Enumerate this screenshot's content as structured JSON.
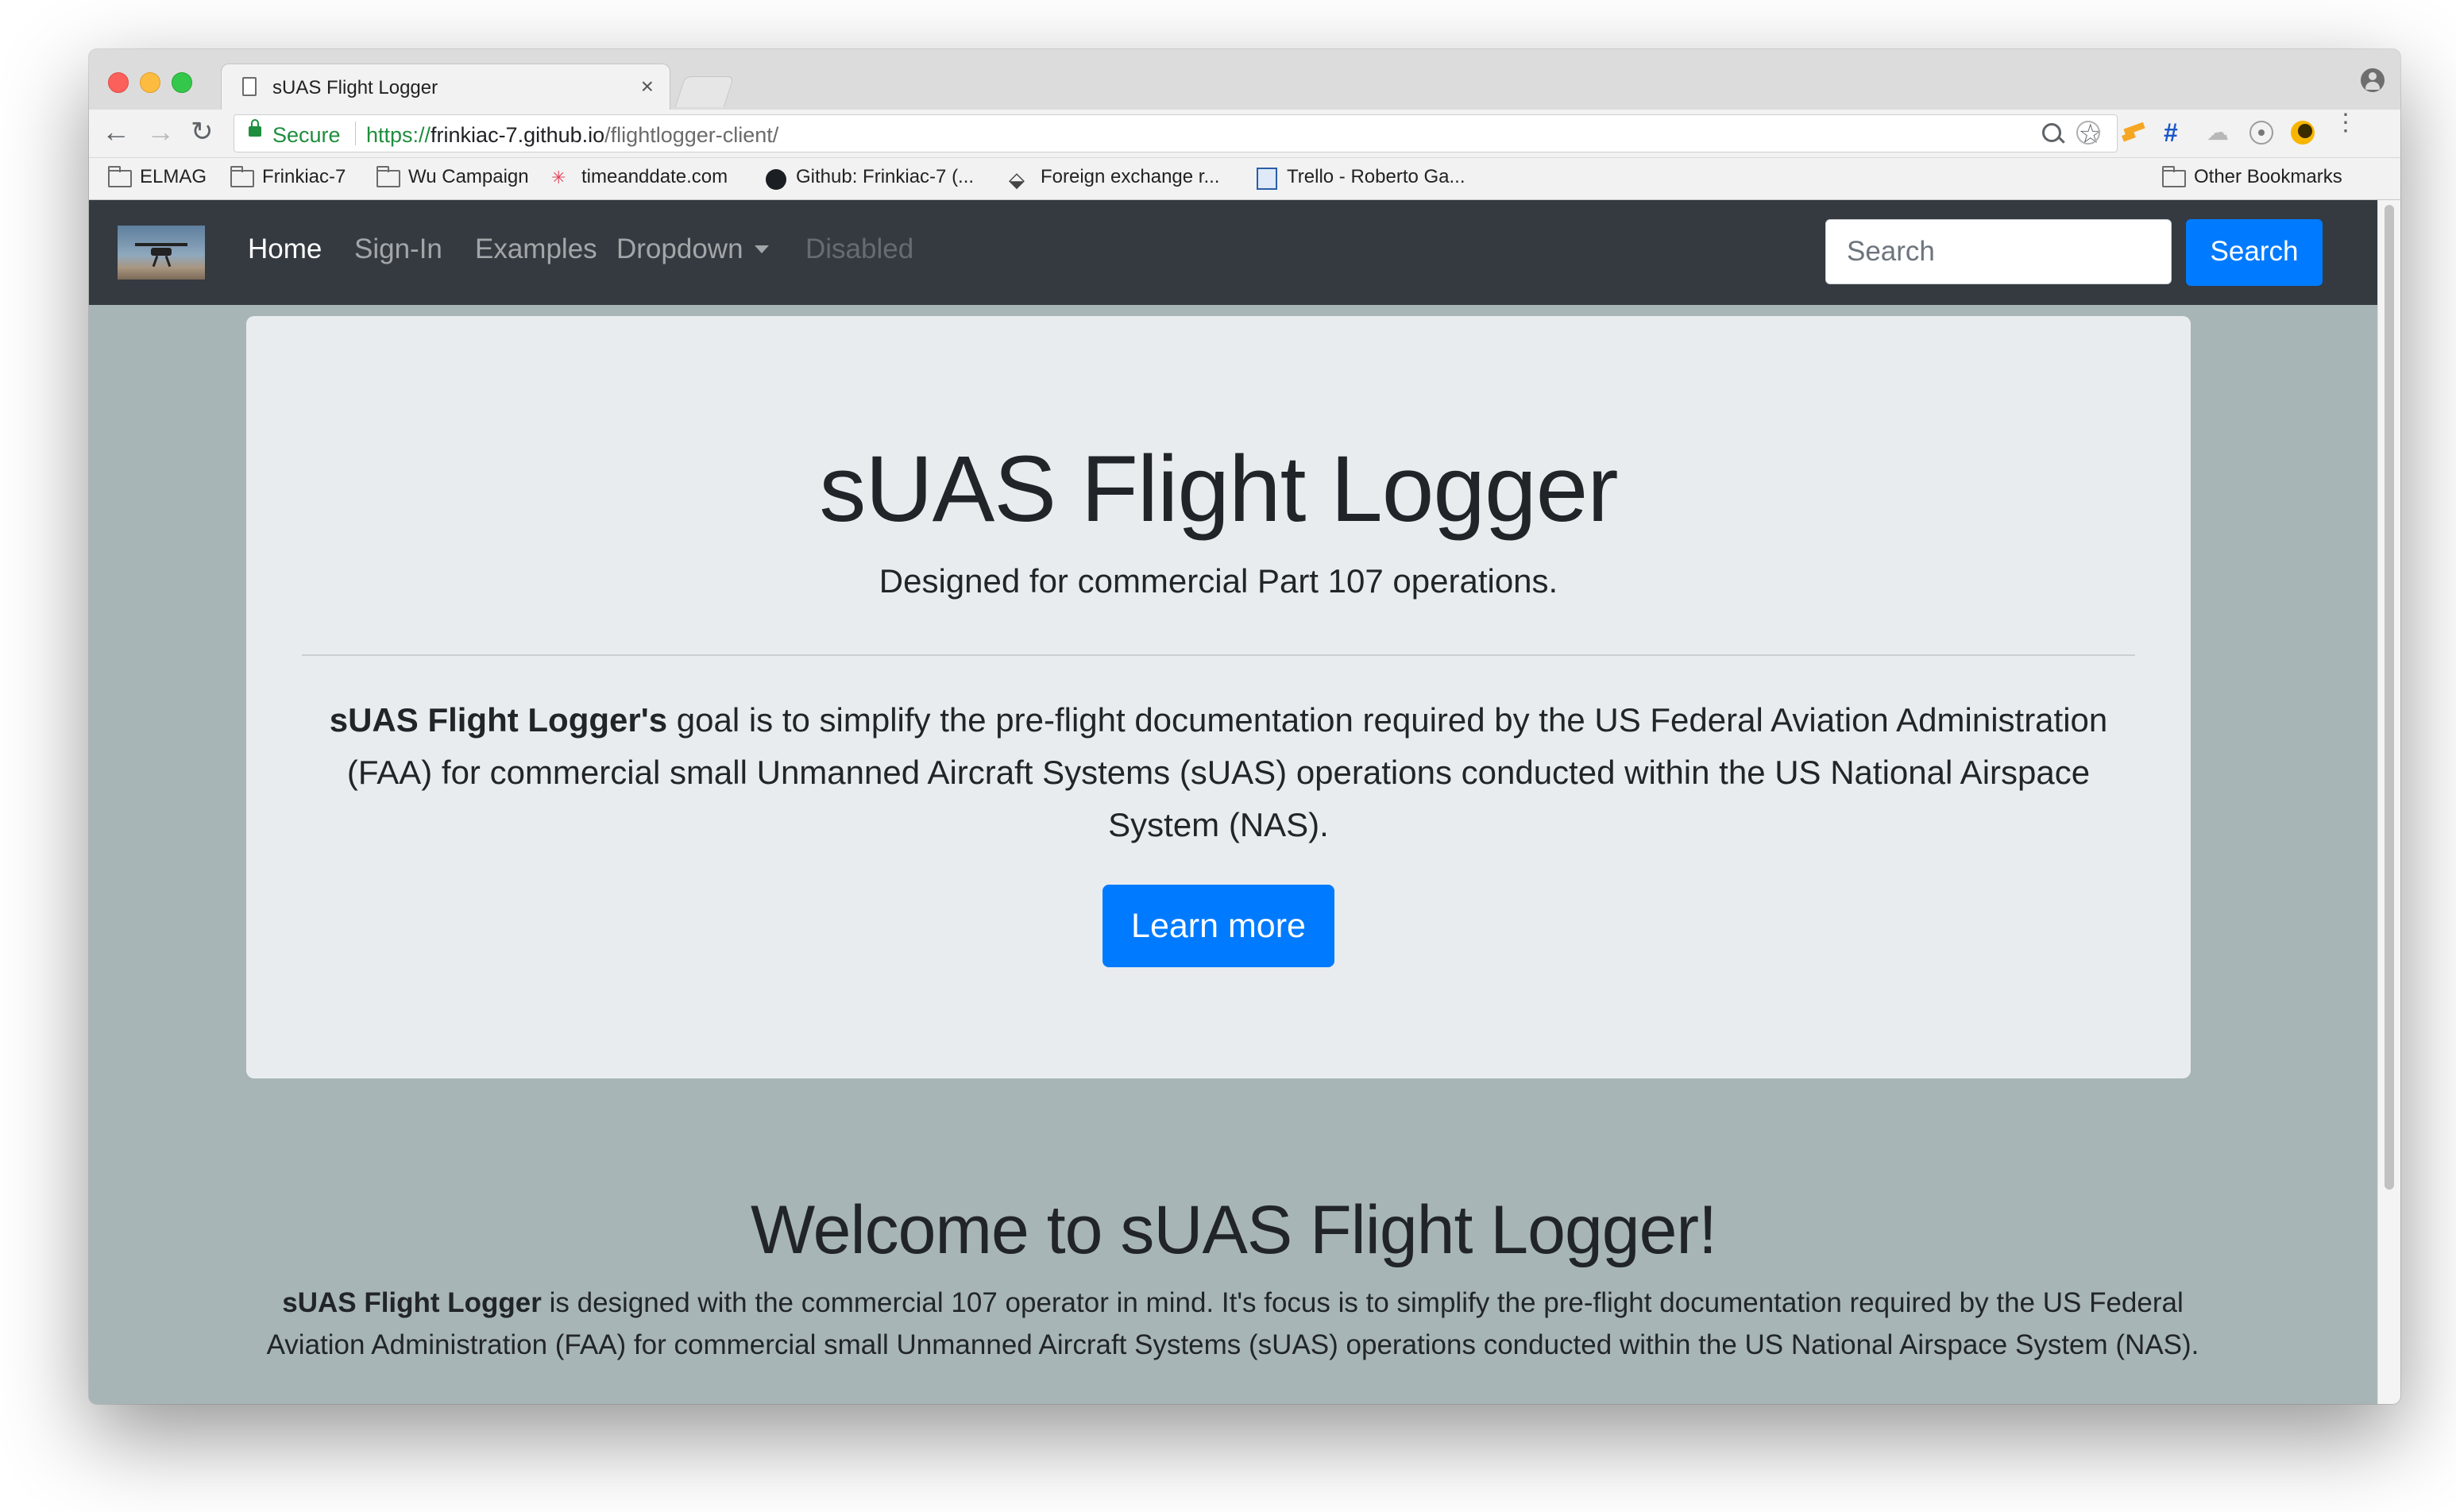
{
  "browser": {
    "tab": {
      "title": "sUAS Flight Logger",
      "close": "×"
    },
    "toolbar": {
      "back": "←",
      "forward": "→",
      "reload": "↻",
      "secure_label": "Secure",
      "url_scheme": "https://",
      "url_host": "frinkiac-7.github.io",
      "url_path": "/flightlogger-client/",
      "star": "☆",
      "menu": "⋮",
      "ext_grid": "#",
      "ext_cloud": "☁"
    },
    "bookmarks": [
      {
        "label": "ELMAG",
        "icon": "folder-icon"
      },
      {
        "label": "Frinkiac-7",
        "icon": "folder-icon"
      },
      {
        "label": "Wu Campaign",
        "icon": "folder-icon"
      },
      {
        "label": "timeanddate.com",
        "icon": "timeanddate-icon"
      },
      {
        "label": "Github: Frinkiac-7 (...",
        "icon": "github-icon"
      },
      {
        "label": "Foreign exchange r...",
        "icon": "fx-icon"
      },
      {
        "label": "Trello - Roberto Ga...",
        "icon": "trello-icon"
      }
    ],
    "other_bookmarks": "Other Bookmarks",
    "bookmark_glyphs": {
      "timeanddate": "✳",
      "fx": "⬙"
    }
  },
  "navbar": {
    "links": [
      {
        "label": "Home",
        "state": "active"
      },
      {
        "label": "Sign-In",
        "state": "normal"
      },
      {
        "label": "Examples",
        "state": "normal"
      },
      {
        "label": "Dropdown",
        "state": "normal"
      },
      {
        "label": "Disabled",
        "state": "disabled"
      }
    ],
    "search_placeholder": "Search",
    "search_button": "Search"
  },
  "jumbotron": {
    "title": "sUAS Flight Logger",
    "lead": "Designed for commercial Part 107 operations.",
    "text_strong": "sUAS Flight Logger's",
    "text": " goal is to simplify the pre-flight documentation required by the US Federal Aviation Administration (FAA) for commercial small Unmanned Aircraft Systems (sUAS) operations conducted within the US National Airspace System (NAS).",
    "button": "Learn more"
  },
  "welcome": {
    "title": "Welcome to sUAS Flight Logger!",
    "text_strong": "sUAS Flight Logger",
    "text": " is designed with the commercial 107 operator in mind. It's focus is to simplify the pre-flight documentation required by the US Federal Aviation Administration (FAA) for commercial small Unmanned Aircraft Systems (sUAS) operations conducted within the US National Airspace System (NAS)."
  },
  "colors": {
    "navbar_bg": "#343a40",
    "page_bg": "#a8b5b6",
    "jumbotron_bg": "#e9ecef",
    "primary": "#007bff",
    "secure_green": "#1e8e3e"
  }
}
